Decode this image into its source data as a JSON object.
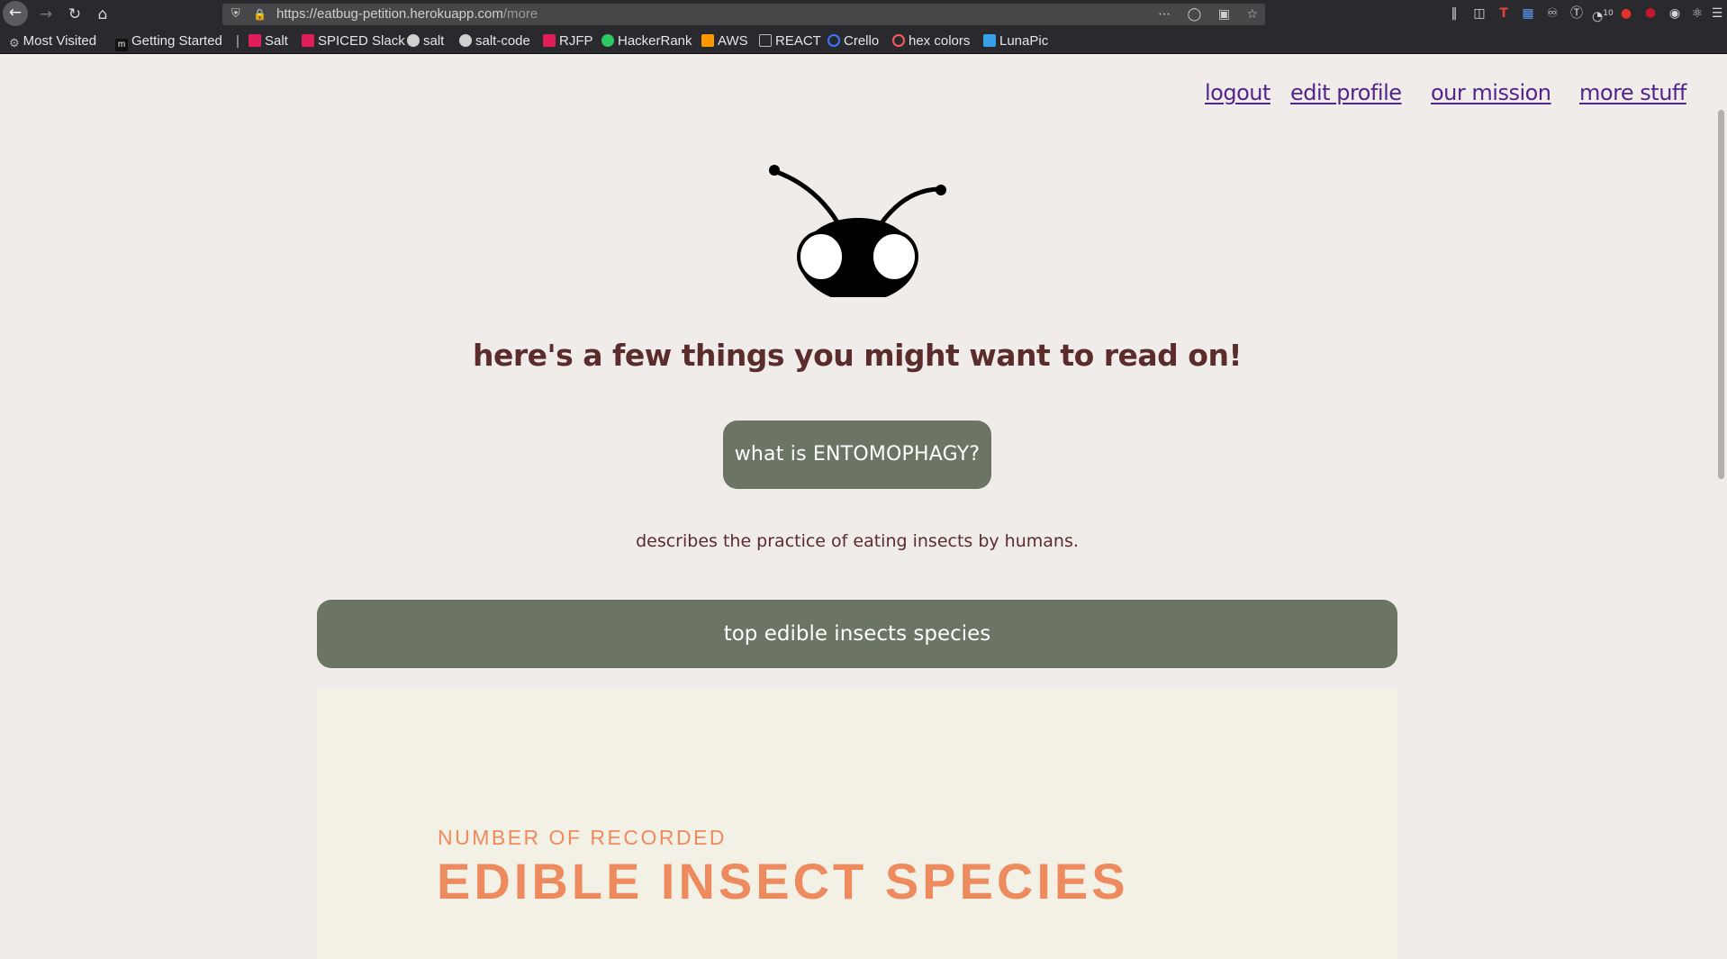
{
  "browser": {
    "url_host": "https://eatbug-petition.herokuapp.com",
    "url_path": "/more",
    "bookmarks": [
      {
        "label": "Most Visited",
        "color": "#b9b9bb"
      },
      {
        "label": "Getting Started",
        "color": "#ffffff"
      },
      {
        "label": "Salt",
        "color": "#e01e5a"
      },
      {
        "label": "SPICED Slack",
        "color": "#e01e5a"
      },
      {
        "label": "salt",
        "color": "#d0d0d0"
      },
      {
        "label": "salt-code",
        "color": "#d0d0d0"
      },
      {
        "label": "RJFP",
        "color": "#e01e5a"
      },
      {
        "label": "HackerRank",
        "color": "#2ec866"
      },
      {
        "label": "AWS",
        "color": "#f90"
      },
      {
        "label": "REACT",
        "color": "#bbbbbb"
      },
      {
        "label": "Crello",
        "color": "#3a78ff"
      },
      {
        "label": "hex colors",
        "color": "#ff5a5a"
      },
      {
        "label": "LunaPic",
        "color": "#38a0e8"
      }
    ],
    "badge_count": "10"
  },
  "nav": {
    "logout": "logout",
    "edit_profile": "edit profile",
    "our_mission": "our mission",
    "more_stuff": "more stuff"
  },
  "main": {
    "heading": "here's a few things you might want to read on!",
    "entomophagy_button": "what is ENTOMOPHAGY?",
    "description": "describes the practice of eating insects by humans.",
    "species_button": "top edible insects species",
    "panel_subtitle": "NUMBER OF RECORDED",
    "panel_title": "EDIBLE INSECT SPECIES"
  },
  "colors": {
    "link": "#53248a",
    "heading": "#5b2c2c",
    "button": "#6c7563",
    "panel_bg": "#f3f0e5",
    "panel_text": "#ee8b5e"
  }
}
